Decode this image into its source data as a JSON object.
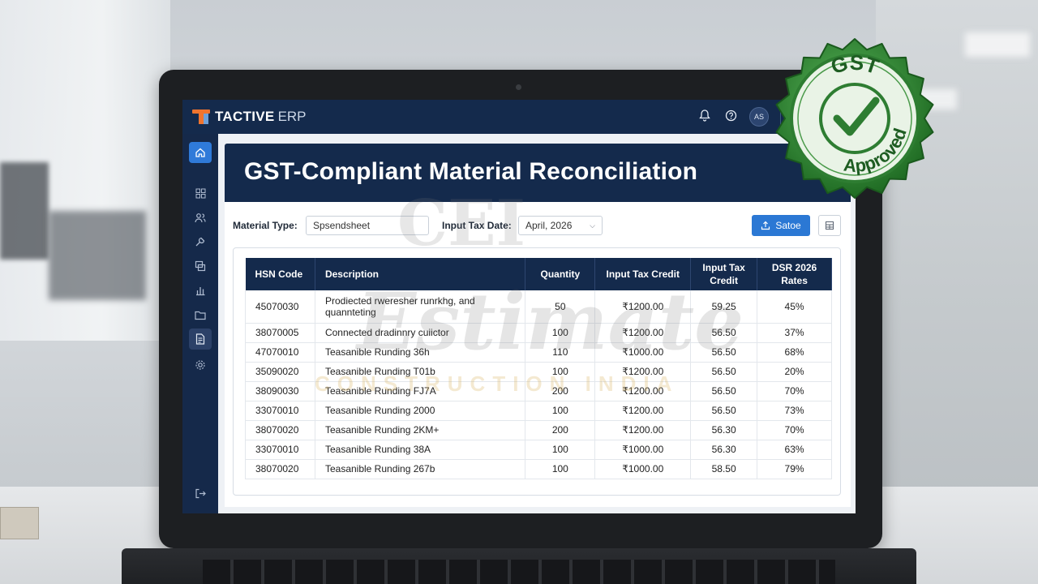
{
  "app": {
    "brand_name": "TACTIVE",
    "brand_suffix": "ERP",
    "user_initials": "AS"
  },
  "icons": {
    "topbar": [
      "bell-icon",
      "help-icon"
    ],
    "sidebar": [
      "home-icon",
      "grid-icon",
      "users-icon",
      "tools-icon",
      "layers-icon",
      "chart-icon",
      "folder-icon",
      "document-icon",
      "settings-icon",
      "logout-icon"
    ]
  },
  "page": {
    "title": "GST-Compliant Material Reconciliation"
  },
  "filters": {
    "material_type_label": "Material Type:",
    "material_type_value": "Spsendsheet",
    "input_tax_date_label": "Input Tax Date:",
    "input_tax_date_value": "April, 2026"
  },
  "actions": {
    "primary_label": "Satoe"
  },
  "table": {
    "headers": {
      "hsn": "HSN Code",
      "description": "Description",
      "quantity": "Quantity",
      "input_tax_credit": "Input Tax Credit",
      "input_tax_credit_2": "Input Tax Credit",
      "dsr_rates": "DSR 2026 Rates"
    },
    "rows": [
      {
        "hsn": "45070030",
        "description": "Prodiected rweresher runrkhg, and quannteting",
        "quantity": "50",
        "credit": "₹1200.00",
        "credit2": "59.25",
        "rate": "45%"
      },
      {
        "hsn": "38070005",
        "description": "Connected dradinnry cuiictor",
        "quantity": "100",
        "credit": "₹1200.00",
        "credit2": "56.50",
        "rate": "37%"
      },
      {
        "hsn": "47070010",
        "description": "Teasanible Runding 36h",
        "quantity": "110",
        "credit": "₹1000.00",
        "credit2": "56.50",
        "rate": "68%"
      },
      {
        "hsn": "35090020",
        "description": "Teasanible Runding T01b",
        "quantity": "100",
        "credit": "₹1200.00",
        "credit2": "56.50",
        "rate": "20%"
      },
      {
        "hsn": "38090030",
        "description": "Teasanible Runding FJ7A",
        "quantity": "200",
        "credit": "₹1200.00",
        "credit2": "56.50",
        "rate": "70%"
      },
      {
        "hsn": "33070010",
        "description": "Teasanible Runding 2000",
        "quantity": "100",
        "credit": "₹1200.00",
        "credit2": "56.50",
        "rate": "73%"
      },
      {
        "hsn": "38070020",
        "description": "Teasanible Runding 2KM+",
        "quantity": "200",
        "credit": "₹1200.00",
        "credit2": "56.30",
        "rate": "70%"
      },
      {
        "hsn": "33070010",
        "description": "Teasanible Runding 38A",
        "quantity": "100",
        "credit": "₹1000.00",
        "credit2": "56.30",
        "rate": "63%"
      },
      {
        "hsn": "38070020",
        "description": "Teasanible Runding 267b",
        "quantity": "100",
        "credit": "₹1000.00",
        "credit2": "58.50",
        "rate": "79%"
      }
    ]
  },
  "watermark": {
    "line1": "CEI",
    "line2": "Estimate",
    "line3": "CONSTRUCTION INDIA"
  },
  "badge": {
    "top_text": "GST",
    "bottom_text": "Approved",
    "color": "#2e8b2e"
  }
}
